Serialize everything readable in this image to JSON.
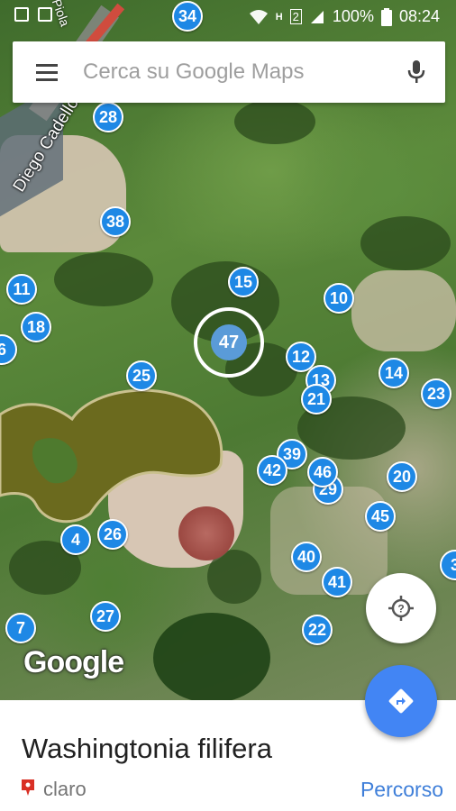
{
  "status_bar": {
    "battery": "100%",
    "time": "08:24",
    "sim": "2"
  },
  "search": {
    "placeholder": "Cerca su Google Maps"
  },
  "map": {
    "street_label": "Diego Cadello",
    "street_label_2": "Piola",
    "logo": "Google",
    "markers": [
      "34",
      "28",
      "38",
      "15",
      "10",
      "11",
      "18",
      "6",
      "47",
      "12",
      "13",
      "21",
      "14",
      "23",
      "25",
      "39",
      "42",
      "46",
      "29",
      "20",
      "45",
      "4",
      "26",
      "40",
      "41",
      "3",
      "7",
      "27",
      "22"
    ],
    "selected_marker": "47"
  },
  "sheet": {
    "title": "Washingtonia filifera",
    "subtitle": "claro",
    "route_label": "Percorso"
  },
  "colors": {
    "accent": "#4285f4",
    "marker": "#1e88e5",
    "link": "#3f7fd9"
  }
}
